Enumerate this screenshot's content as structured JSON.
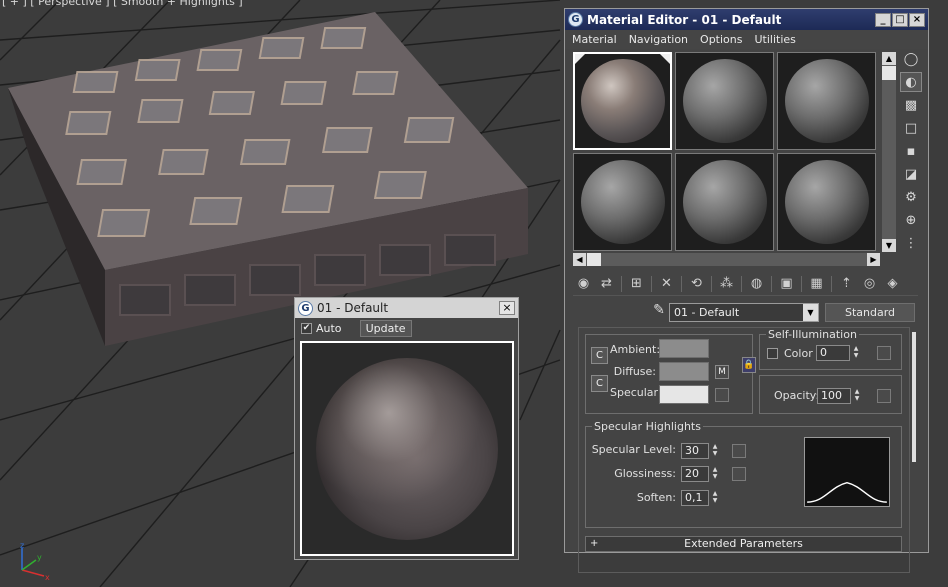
{
  "viewport": {
    "label": "[ + ] [ Perspective ] [ Smooth + Highlights ]",
    "grid_color": "#1c1c1c",
    "axis": {
      "x": "x",
      "y": "y",
      "z": "z"
    }
  },
  "material_editor": {
    "title": "Material Editor - 01 - Default",
    "window_buttons": [
      "_",
      "□",
      "×"
    ],
    "menu": [
      "Material",
      "Navigation",
      "Options",
      "Utilities"
    ],
    "slot_count": 6,
    "material_name": "01 - Default",
    "material_type": "Standard",
    "basic_params": {
      "ambient_label": "Ambient:",
      "diffuse_label": "Diffuse:",
      "specular_label": "Specular:",
      "ambient_color": "#8c8c8c",
      "diffuse_color": "#8c8c8c",
      "specular_color": "#e6e6e6",
      "diffuse_map_button": "M",
      "lock_button_1": "C",
      "lock_button_2": "C"
    },
    "self_illumination": {
      "group_title": "Self-Illumination",
      "color_label": "Color",
      "value": "0"
    },
    "opacity": {
      "label": "Opacity:",
      "value": "100"
    },
    "specular_highlights": {
      "group_title": "Specular Highlights",
      "level_label": "Specular Level:",
      "level_value": "30",
      "gloss_label": "Glossiness:",
      "gloss_value": "20",
      "soften_label": "Soften:",
      "soften_value": "0,1"
    },
    "extended_params": {
      "plus": "+",
      "label": "Extended Parameters"
    }
  },
  "preview_window": {
    "title": "01 - Default",
    "close": "×",
    "auto_label": "Auto",
    "auto_checked": "✔",
    "update_label": "Update"
  }
}
